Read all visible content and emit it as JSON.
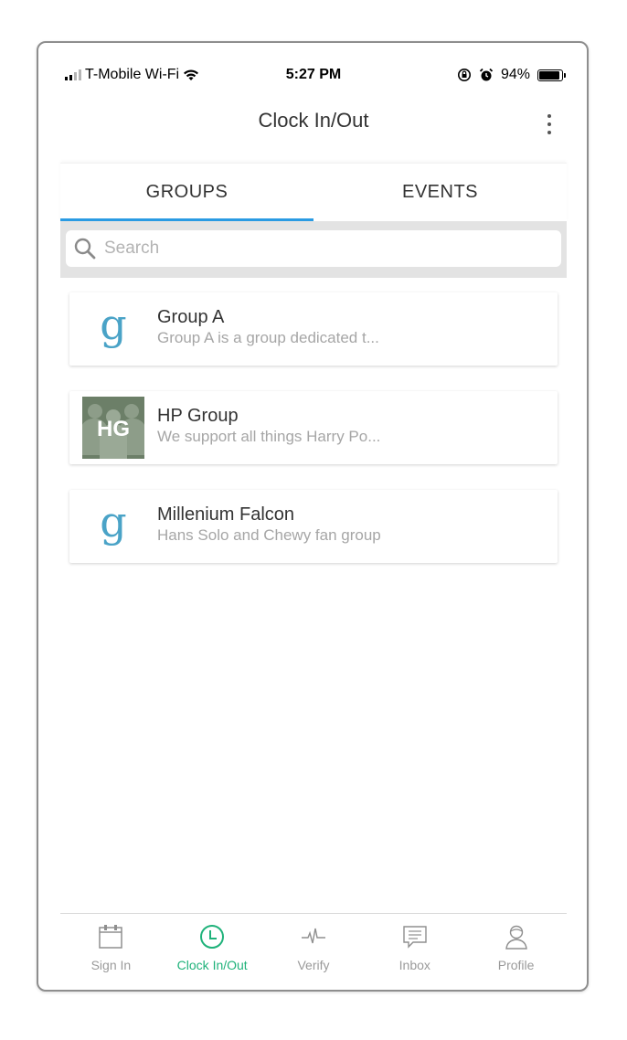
{
  "status_bar": {
    "carrier": "T-Mobile Wi-Fi",
    "time": "5:27 PM",
    "battery": "94%"
  },
  "header": {
    "title": "Clock In/Out"
  },
  "tabs": [
    {
      "label": "GROUPS",
      "active": true
    },
    {
      "label": "EVENTS",
      "active": false
    }
  ],
  "search": {
    "placeholder": "Search",
    "value": ""
  },
  "groups": [
    {
      "name": "Group A",
      "description": "Group A is a group dedicated t...",
      "icon": "g-logo-icon"
    },
    {
      "name": "HP Group",
      "description": "We support all things Harry Po...",
      "icon": "hg-avatar",
      "avatar_text": "HG"
    },
    {
      "name": "Millenium Falcon",
      "description": "Hans Solo and Chewy fan group",
      "icon": "g-logo-icon"
    }
  ],
  "bottom_nav": [
    {
      "label": "Sign In",
      "icon": "calendar-icon",
      "active": false
    },
    {
      "label": "Clock In/Out",
      "icon": "clock-icon",
      "active": true
    },
    {
      "label": "Verify",
      "icon": "pulse-icon",
      "active": false
    },
    {
      "label": "Inbox",
      "icon": "message-icon",
      "active": false
    },
    {
      "label": "Profile",
      "icon": "person-icon",
      "active": false
    }
  ],
  "colors": {
    "tab_indicator": "#2a9be3",
    "active_nav": "#1fb27a",
    "logo": "#4aa3c7"
  }
}
